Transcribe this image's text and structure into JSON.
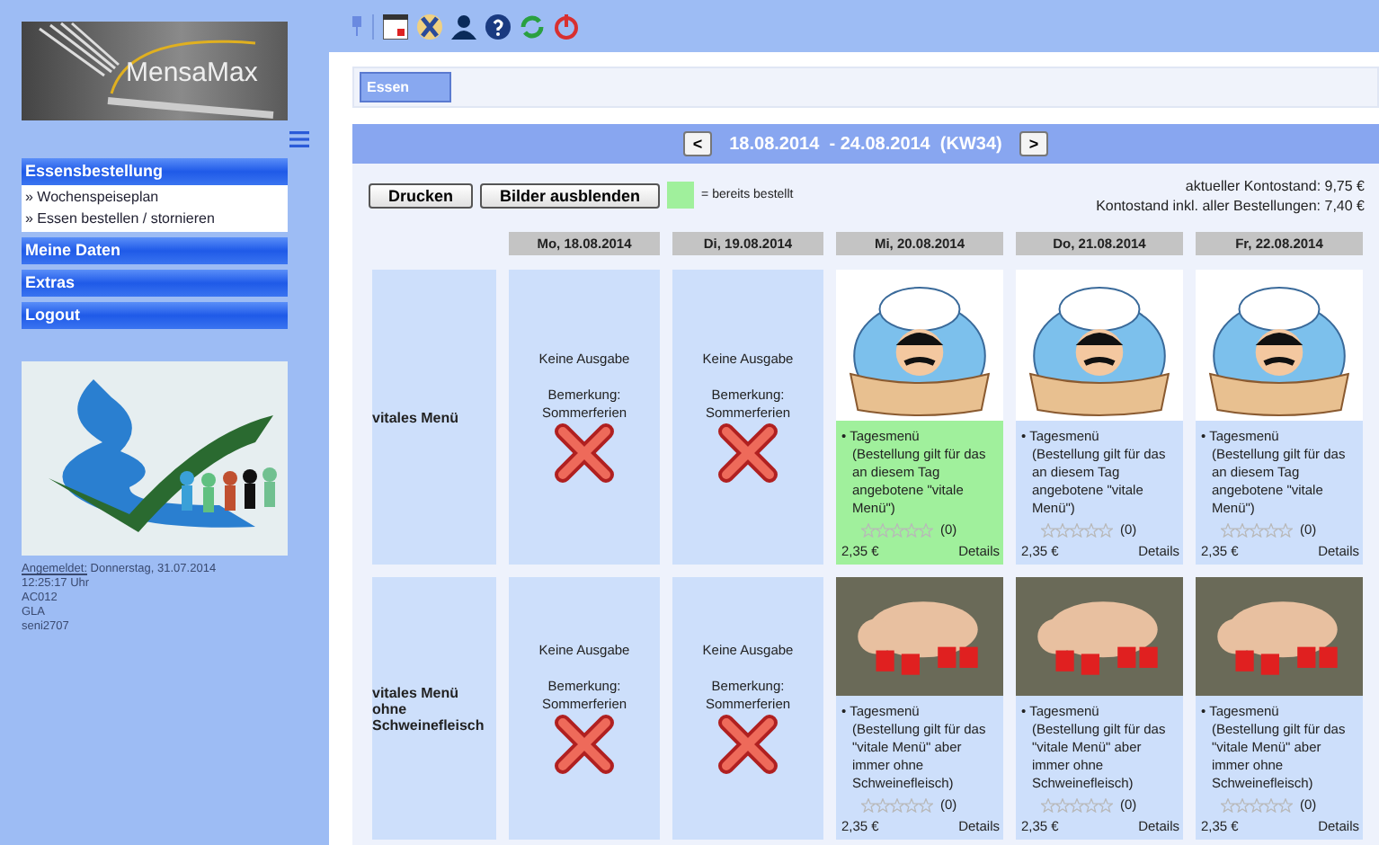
{
  "sidebar": {
    "logo_text": "MensaMax",
    "menu": [
      {
        "label": "Essensbestellung",
        "children": [
          {
            "label": "» Wochenspeiseplan"
          },
          {
            "label": "» Essen bestellen / stornieren"
          }
        ]
      },
      {
        "label": "Meine Daten"
      },
      {
        "label": "Extras"
      },
      {
        "label": "Logout"
      }
    ],
    "login": {
      "label": "Angemeldet:",
      "date": "Donnerstag, 31.07.2014",
      "lines": [
        "12:25:17 Uhr",
        "AC012",
        "GLA",
        "seni2707"
      ]
    }
  },
  "tabs": [
    {
      "label": "Essen",
      "selected": true
    }
  ],
  "week": {
    "prev": "<",
    "range": "18.08.2014  - 24.08.2014  (KW34)",
    "next": ">"
  },
  "buttons": [
    "Drucken",
    "Bilder ausblenden"
  ],
  "legend": "= bereits bestellt",
  "balance": [
    "aktueller Kontostand: 9,75 €",
    "Kontostand inkl. aller Bestellungen: 7,40 €"
  ],
  "days": [
    "Mo, 18.08.2014",
    "Di, 19.08.2014",
    "Mi, 20.08.2014",
    "Do, 21.08.2014",
    "Fr, 22.08.2014"
  ],
  "rows": [
    {
      "label": "vitales Menü",
      "cells": [
        {
          "kind": "closed",
          "status": "Keine Ausgabe",
          "remark_label": "Bemerkung:",
          "remark": "Sommerferien"
        },
        {
          "kind": "closed",
          "status": "Keine Ausgabe",
          "remark_label": "Bemerkung:",
          "remark": "Sommerferien"
        },
        {
          "kind": "menu",
          "ordered": true,
          "title": "• Tagesmenü",
          "description": "(Bestellung gilt für das an diesem Tag angebotene \"vitale Menü\")",
          "stars": 0,
          "rating": "(0)",
          "price": "2,35 €",
          "details": "Details"
        },
        {
          "kind": "menu",
          "ordered": false,
          "title": "• Tagesmenü",
          "description": "(Bestellung gilt für das an diesem Tag angebotene \"vitale Menü\")",
          "stars": 0,
          "rating": "(0)",
          "price": "2,35 €",
          "details": "Details"
        },
        {
          "kind": "menu",
          "ordered": false,
          "title": "• Tagesmenü",
          "description": "(Bestellung gilt für das an diesem Tag angebotene \"vitale Menü\")",
          "stars": 0,
          "rating": "(0)",
          "price": "2,35 €",
          "details": "Details"
        }
      ]
    },
    {
      "label": "vitales Menü ohne Schweinefleisch",
      "cells": [
        {
          "kind": "closed",
          "status": "Keine Ausgabe",
          "remark_label": "Bemerkung:",
          "remark": "Sommerferien"
        },
        {
          "kind": "closed",
          "status": "Keine Ausgabe",
          "remark_label": "Bemerkung:",
          "remark": "Sommerferien"
        },
        {
          "kind": "menu",
          "ordered": false,
          "title": "• Tagesmenü",
          "description": "(Bestellung gilt für das \"vitale Menü\" aber immer ohne Schweinefleisch)",
          "stars": 0,
          "rating": "(0)",
          "price": "2,35 €",
          "details": "Details"
        },
        {
          "kind": "menu",
          "ordered": false,
          "title": "• Tagesmenü",
          "description": "(Bestellung gilt für das \"vitale Menü\" aber immer ohne Schweinefleisch)",
          "stars": 0,
          "rating": "(0)",
          "price": "2,35 €",
          "details": "Details"
        },
        {
          "kind": "menu",
          "ordered": false,
          "title": "• Tagesmenü",
          "description": "(Bestellung gilt für das \"vitale Menü\" aber immer ohne Schweinefleisch)",
          "stars": 0,
          "rating": "(0)",
          "price": "2,35 €",
          "details": "Details"
        }
      ]
    }
  ]
}
